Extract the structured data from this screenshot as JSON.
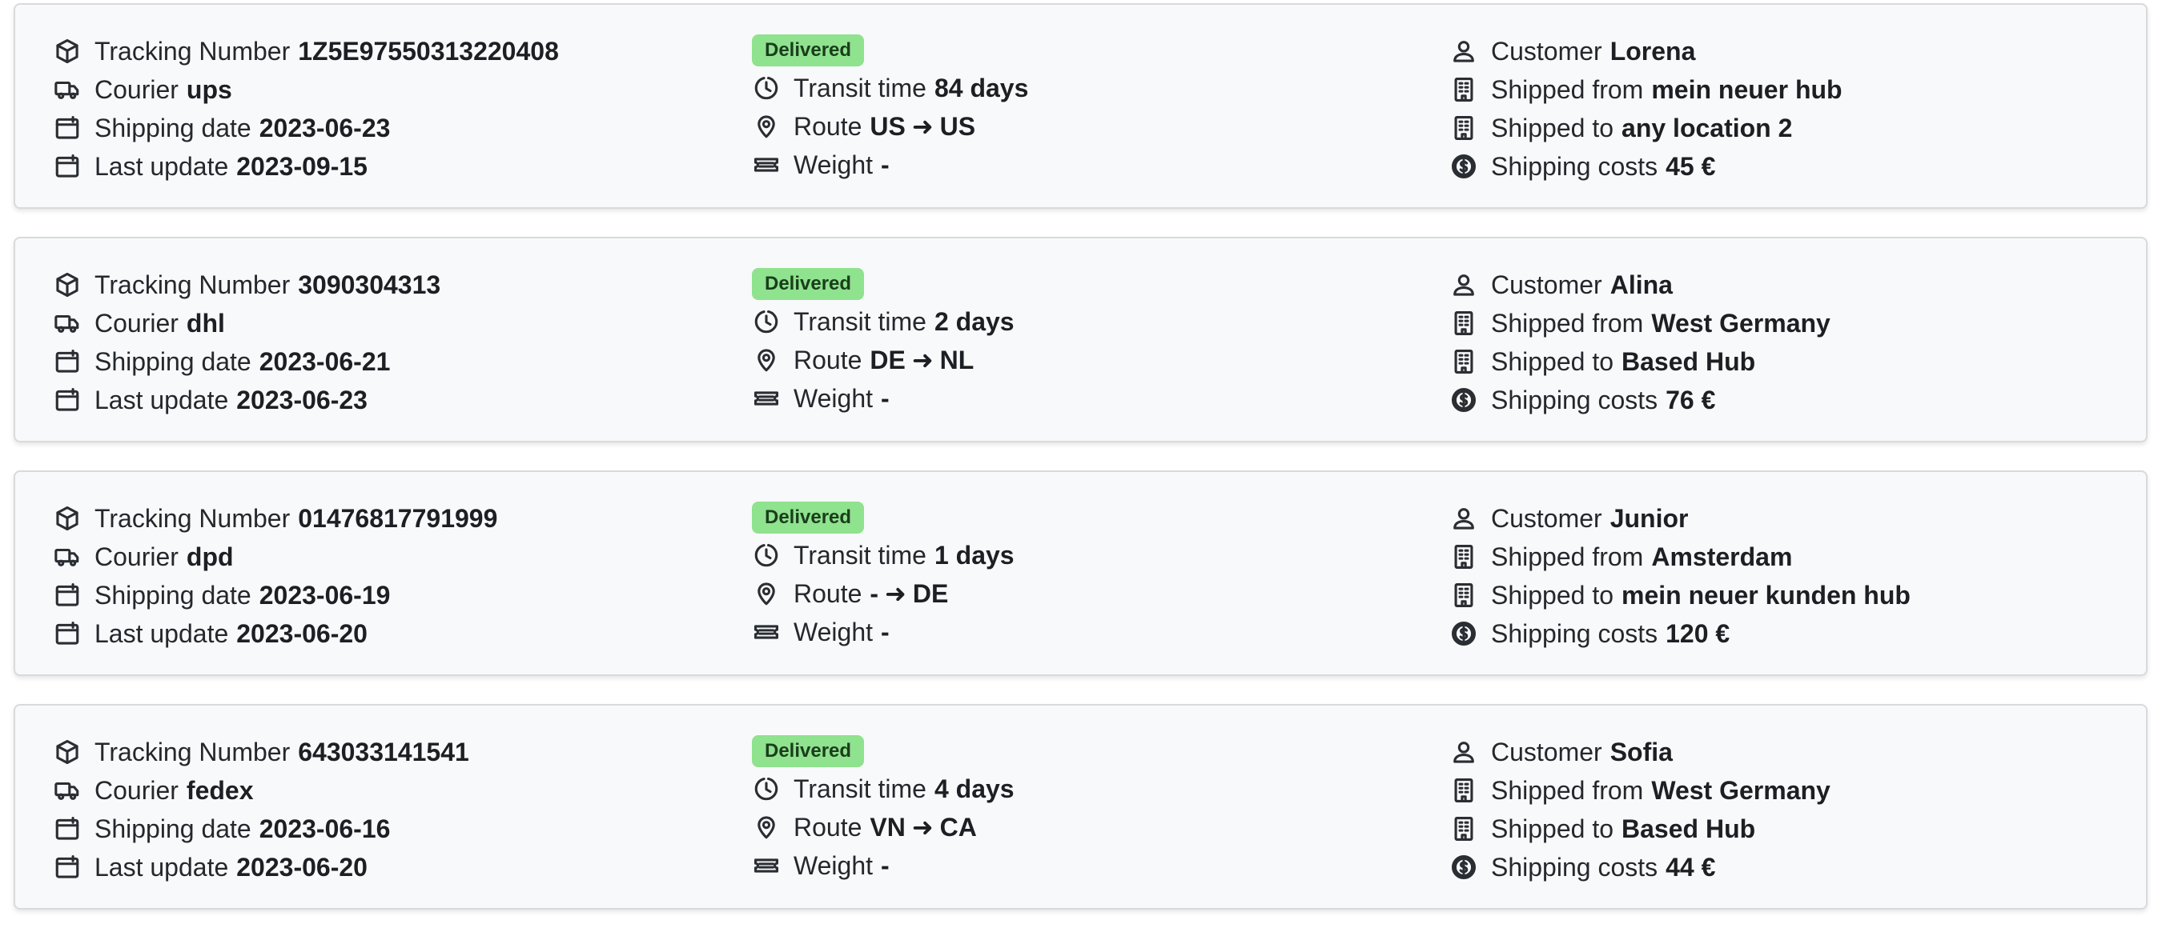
{
  "labels": {
    "tracking": "Tracking Number",
    "courier": "Courier",
    "shipping_date": "Shipping date",
    "last_update": "Last update",
    "transit": "Transit time",
    "route": "Route",
    "weight": "Weight",
    "customer": "Customer",
    "from": "Shipped from",
    "to": "Shipped to",
    "costs": "Shipping costs"
  },
  "colors": {
    "badge_bg": "#8fe28e",
    "card_bg": "#f8f9fa",
    "card_border": "#d8dadd"
  },
  "shipments": [
    {
      "tracking_number": "1Z5E97550313220408",
      "courier": "ups",
      "shipping_date": "2023-06-23",
      "last_update": "2023-09-15",
      "status": "Delivered",
      "transit_time": "84 days",
      "route_from": "US",
      "route_to": "US",
      "weight": "-",
      "customer": "Lorena",
      "shipped_from": "mein neuer hub",
      "shipped_to": "any location 2",
      "shipping_costs": "45 €"
    },
    {
      "tracking_number": "3090304313",
      "courier": "dhl",
      "shipping_date": "2023-06-21",
      "last_update": "2023-06-23",
      "status": "Delivered",
      "transit_time": "2 days",
      "route_from": "DE",
      "route_to": "NL",
      "weight": "-",
      "customer": "Alina",
      "shipped_from": "West Germany",
      "shipped_to": "Based Hub",
      "shipping_costs": "76 €"
    },
    {
      "tracking_number": "01476817791999",
      "courier": "dpd",
      "shipping_date": "2023-06-19",
      "last_update": "2023-06-20",
      "status": "Delivered",
      "transit_time": "1 days",
      "route_from": "-",
      "route_to": "DE",
      "weight": "-",
      "customer": "Junior",
      "shipped_from": "Amsterdam",
      "shipped_to": "mein neuer kunden hub",
      "shipping_costs": "120 €"
    },
    {
      "tracking_number": "643033141541",
      "courier": "fedex",
      "shipping_date": "2023-06-16",
      "last_update": "2023-06-20",
      "status": "Delivered",
      "transit_time": "4 days",
      "route_from": "VN",
      "route_to": "CA",
      "weight": "-",
      "customer": "Sofia",
      "shipped_from": "West Germany",
      "shipped_to": "Based Hub",
      "shipping_costs": "44 €"
    }
  ]
}
